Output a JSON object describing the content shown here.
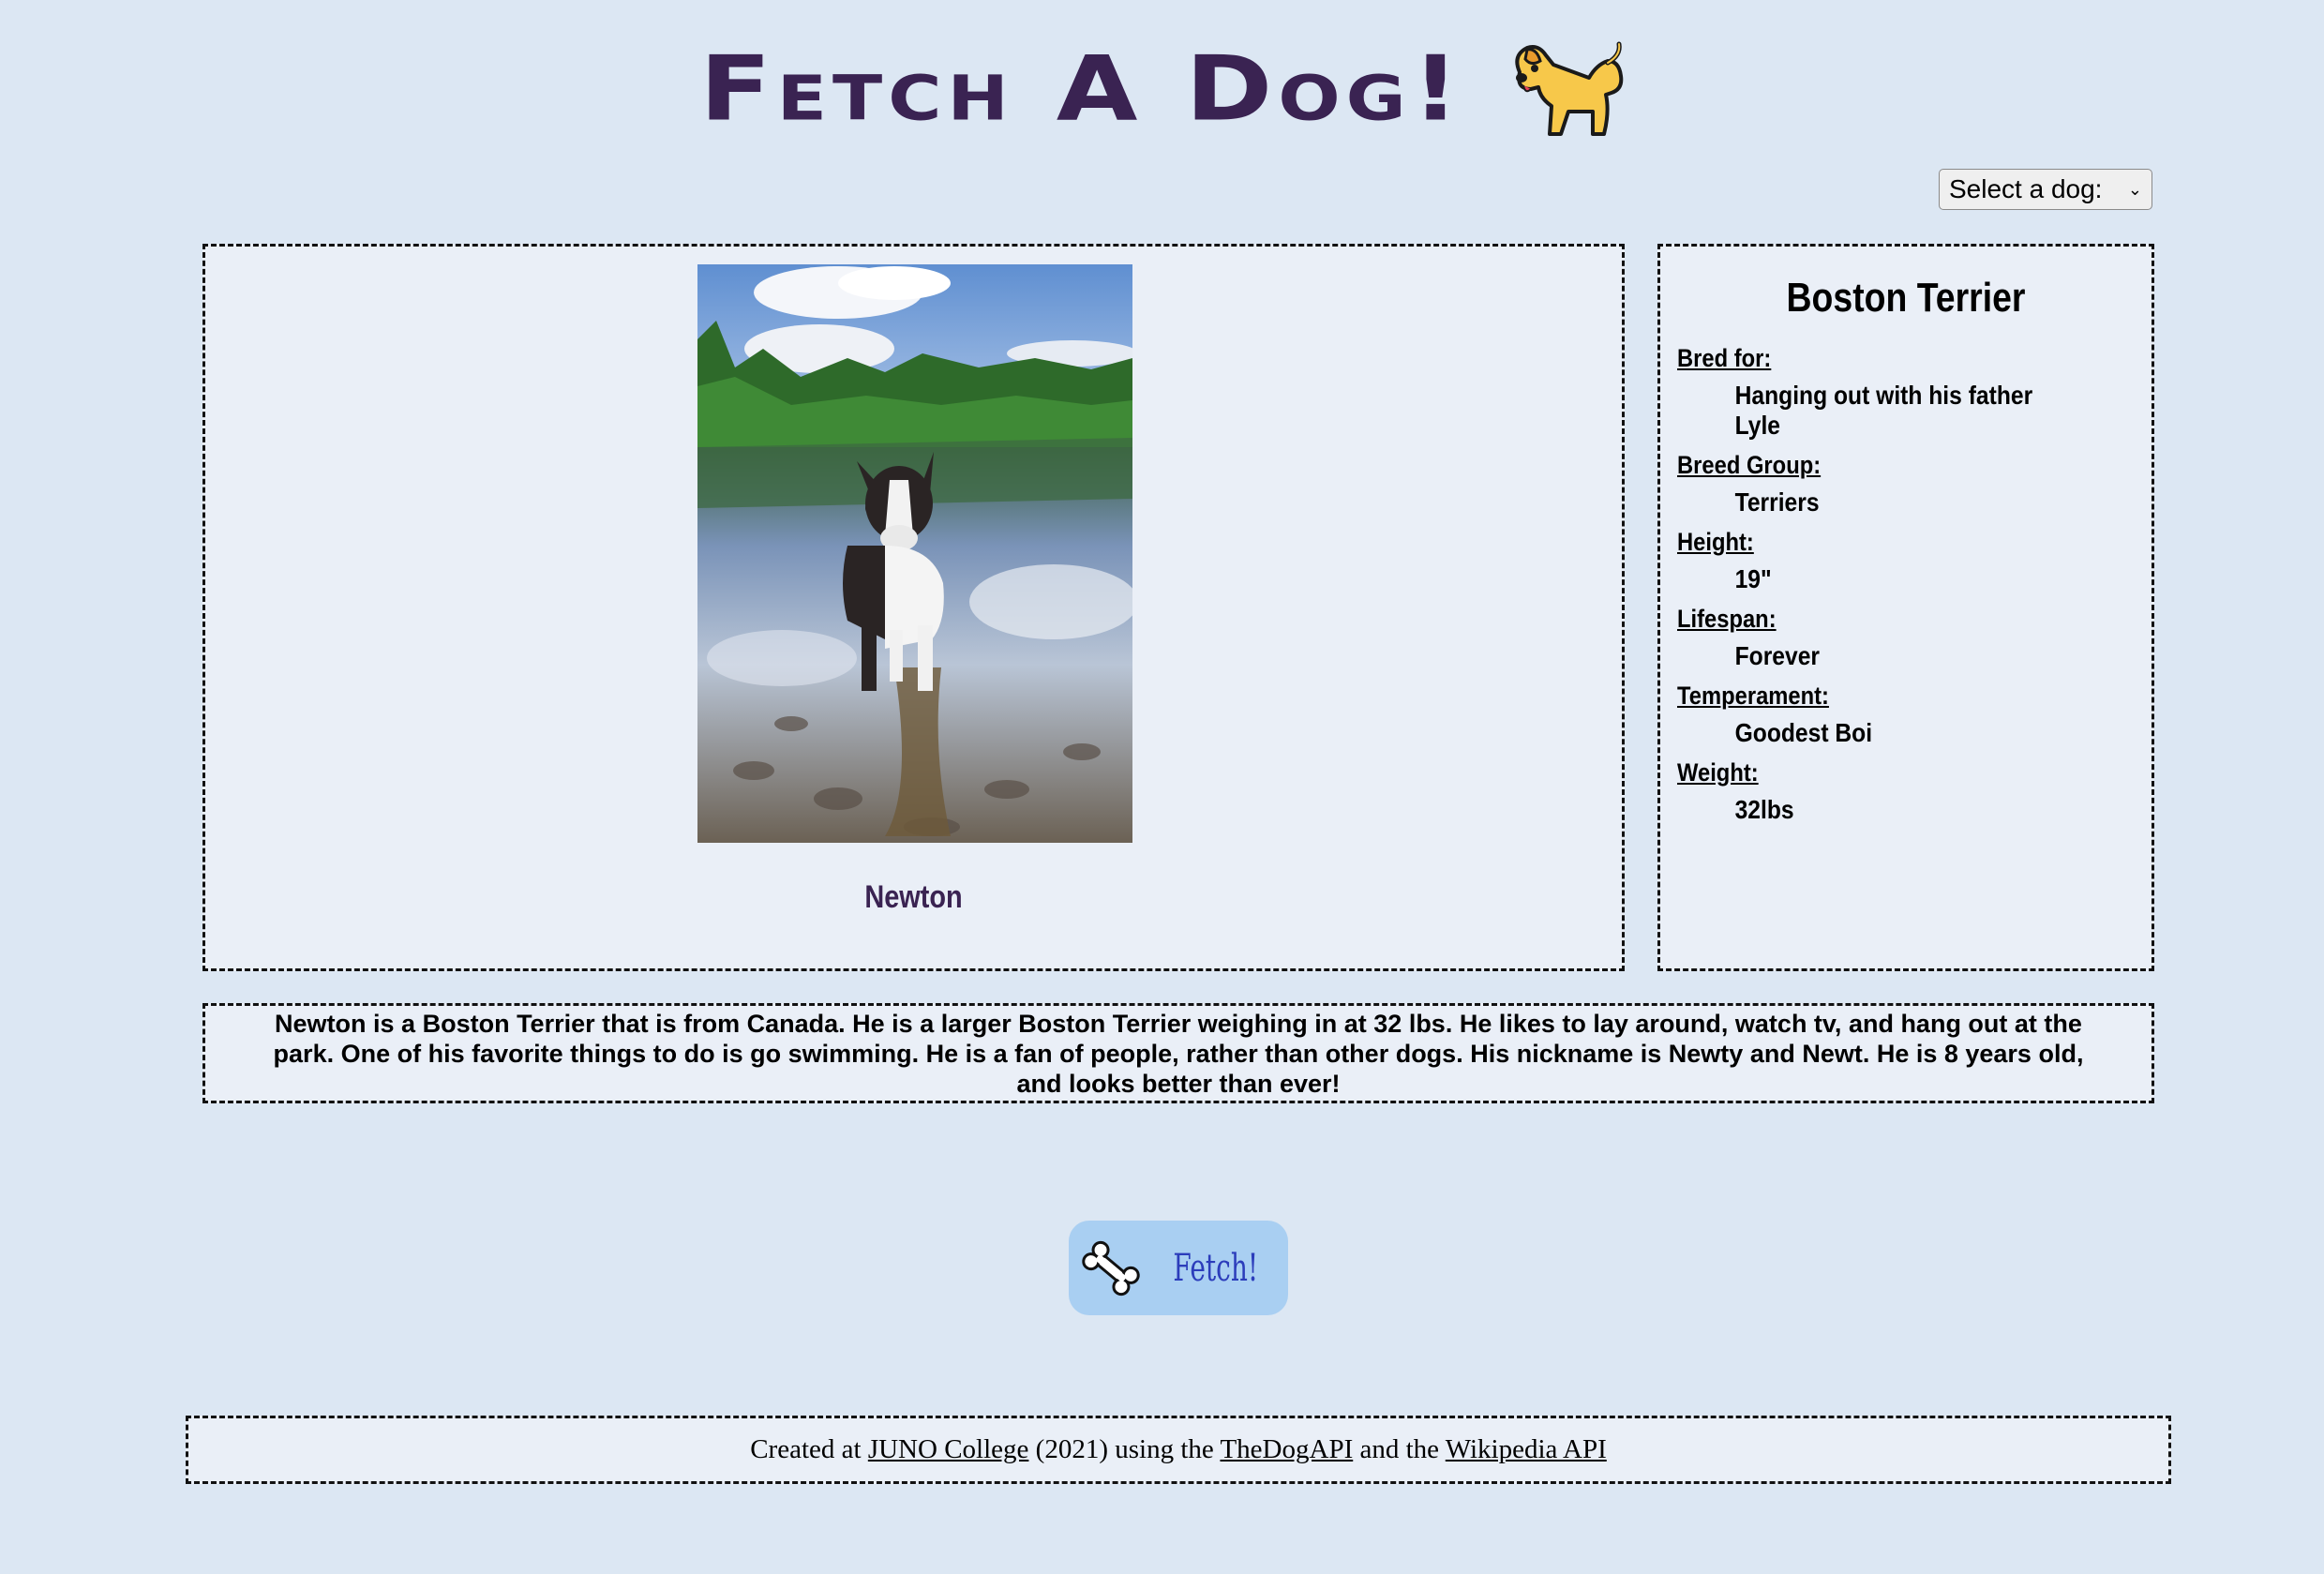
{
  "header": {
    "title": "Fetch A Dog!",
    "icon": "dog-icon"
  },
  "dog_select": {
    "selected": "Select a dog:"
  },
  "main": {
    "dog_name": "Newton"
  },
  "breed_info": {
    "breed": "Boston Terrier",
    "fields": [
      {
        "label": "Bred for:",
        "value": "Hanging out with his father Lyle"
      },
      {
        "label": "Breed Group:",
        "value": "Terriers"
      },
      {
        "label": "Height:",
        "value": "19\""
      },
      {
        "label": "Lifespan:",
        "value": "Forever"
      },
      {
        "label": "Temperament:",
        "value": "Goodest Boi"
      },
      {
        "label": "Weight:",
        "value": "32lbs"
      }
    ]
  },
  "description": "Newton is a Boston Terrier that is from Canada. He is a larger Boston Terrier weighing in at 32 lbs. He likes to lay around, watch tv, and hang out at the park. One of his favorite things to do is go swimming. He is a fan of people, rather than other dogs. His nickname is Newty and Newt. He is 8 years old, and looks better than ever!",
  "fetch_button": {
    "label": "Fetch!",
    "icon": "bone-icon"
  },
  "footer": {
    "prefix": "Created at ",
    "link1": "JUNO College",
    "middle1": " (2021) using the ",
    "link2": "TheDogAPI",
    "middle2": " and the ",
    "link3": "Wikipedia API"
  },
  "colors": {
    "background": "#dce7f3",
    "panel": "#eaeff7",
    "title": "#3a2352",
    "button": "#a9cff2",
    "button_text": "#2c3dbb"
  }
}
